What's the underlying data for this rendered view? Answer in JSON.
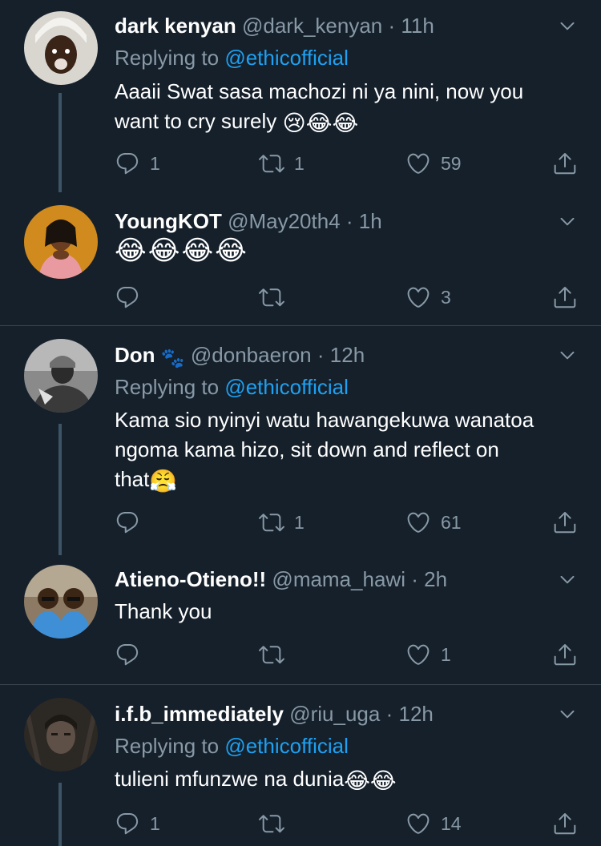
{
  "tweets": [
    {
      "name": "dark kenyan",
      "handle": "@dark_kenyan",
      "dot": "·",
      "time": "11h",
      "replying_prefix": "Replying to",
      "replying_mention": "@ethicofficial",
      "text_line1": "Aaaii Swat sasa machozi ni ya nini, now you",
      "text_line2": "want to cry surely",
      "emojis": "😢😂😂",
      "reply_count": "1",
      "retweet_count": "1",
      "like_count": "59"
    },
    {
      "name": "YoungKOT",
      "handle": "@May20th4",
      "dot": "·",
      "time": "1h",
      "emojis": "😂😂😂😂",
      "like_count": "3"
    },
    {
      "name": "Don",
      "name_emoji": "🐾",
      "handle": "@donbaeron",
      "dot": "·",
      "time": "12h",
      "replying_prefix": "Replying to",
      "replying_mention": "@ethicofficial",
      "text_line1": "Kama sio nyinyi watu hawangekuwa wanatoa",
      "text_line2": "ngoma kama hizo, sit down and reflect on",
      "text_line3": "that",
      "emojis": "😤",
      "retweet_count": "1",
      "like_count": "61"
    },
    {
      "name": "Atieno-Otieno!!",
      "handle": "@mama_hawi",
      "dot": "·",
      "time": "2h",
      "text_line1": "Thank you",
      "like_count": "1"
    },
    {
      "name": "i.f.b_immediately",
      "handle": "@riu_uga",
      "dot": "·",
      "time": "12h",
      "replying_prefix": "Replying to",
      "replying_mention": "@ethicofficial",
      "text_line1": "tulieni mfunzwe na dunia",
      "emojis": "😂😂",
      "reply_count": "1",
      "like_count": "14"
    }
  ],
  "colors": {
    "background": "#15202b",
    "secondary_text": "#8899a6",
    "link": "#1da1f2",
    "divider": "#38444d"
  },
  "icons": {
    "reply": "reply-icon",
    "retweet": "retweet-icon",
    "like": "heart-icon",
    "share": "share-icon",
    "more": "chevron-down-icon"
  }
}
